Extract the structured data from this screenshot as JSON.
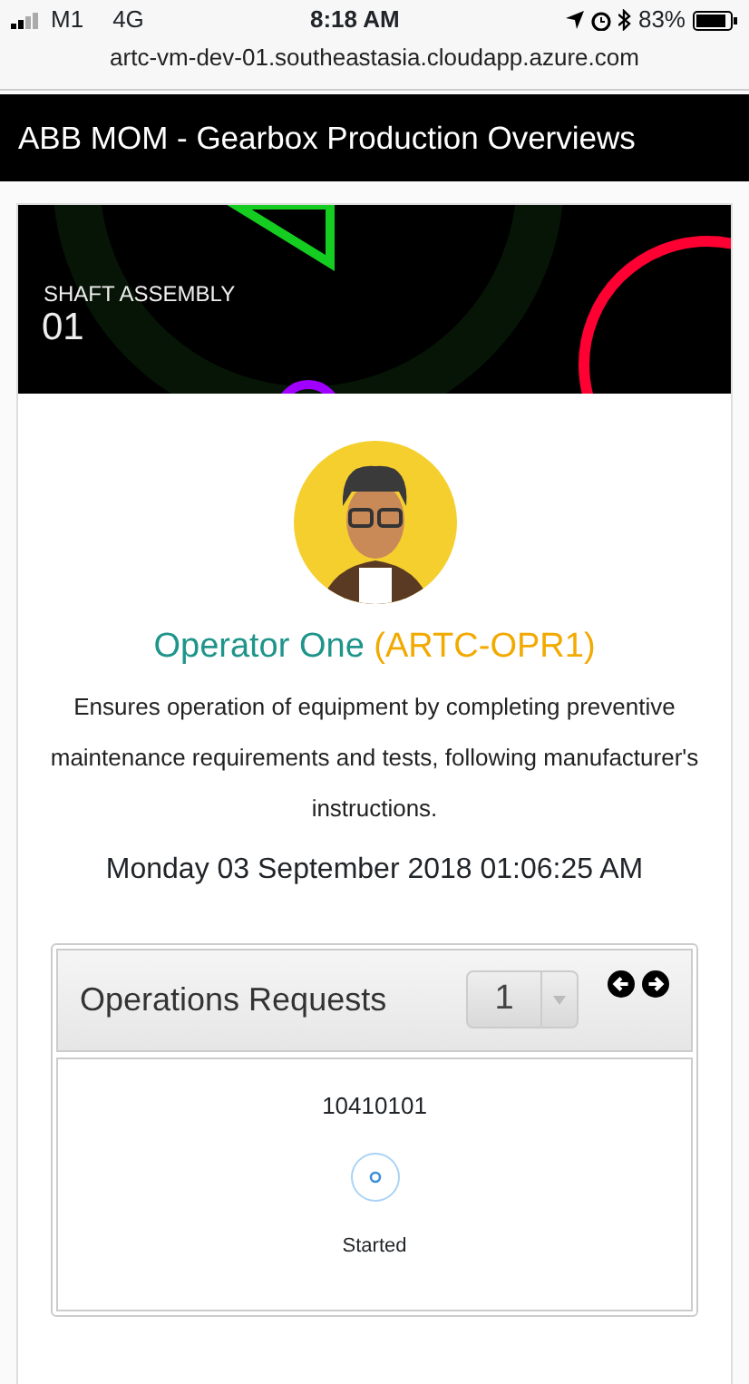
{
  "status_bar": {
    "carrier": "M1",
    "network": "4G",
    "time": "8:18 AM",
    "battery": "83%"
  },
  "address_bar": {
    "url": "artc-vm-dev-01.southeastasia.cloudapp.azure.com"
  },
  "app_bar": {
    "title": "ABB MOM - Gearbox Production Overviews"
  },
  "station": {
    "label": "SHAFT ASSEMBLY",
    "number": "01"
  },
  "operator": {
    "name": "Operator One",
    "code": "(ARTC-OPR1)",
    "description": "Ensures operation of equipment by completing preventive maintenance requirements and tests,  following manufacturer's instructions.",
    "datetime": "Monday 03 September 2018 01:06:25 AM"
  },
  "operations_requests": {
    "title": "Operations Requests",
    "page_select": "1",
    "items": [
      {
        "id": "10410101",
        "status": "Started"
      }
    ]
  }
}
